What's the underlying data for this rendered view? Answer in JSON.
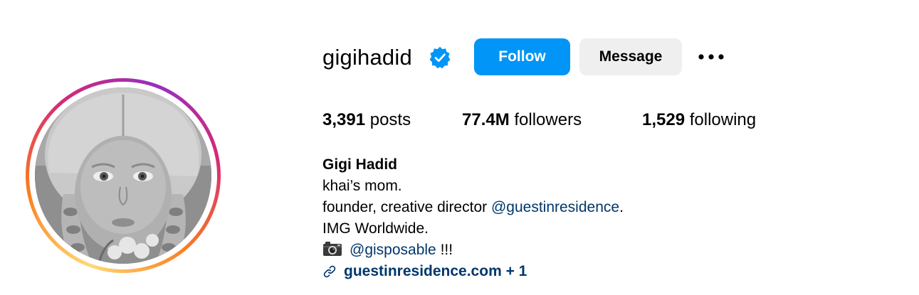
{
  "profile": {
    "username": "gigihadid",
    "verified_icon": "verified-badge-icon",
    "follow_label": "Follow",
    "message_label": "Message",
    "more_icon": "more-options-icon"
  },
  "stats": {
    "posts_count": "3,391",
    "posts_label": "posts",
    "followers_count": "77.4M",
    "followers_label": "followers",
    "following_count": "1,529",
    "following_label": "following"
  },
  "bio": {
    "full_name": "Gigi Hadid",
    "line1": "khai’s mom.",
    "line2_prefix": "founder, creative director ",
    "line2_mention": "@guestinresidence",
    "line2_suffix": ".",
    "line3": "IMG Worldwide.",
    "line4_mention": "@gisposable",
    "line4_suffix": " !!!",
    "link_text": "guestinresidence.com + 1"
  },
  "colors": {
    "follow_button": "#0095f6",
    "message_button": "#efefef",
    "mention_link": "#00376b",
    "verified": "#0095f6"
  }
}
